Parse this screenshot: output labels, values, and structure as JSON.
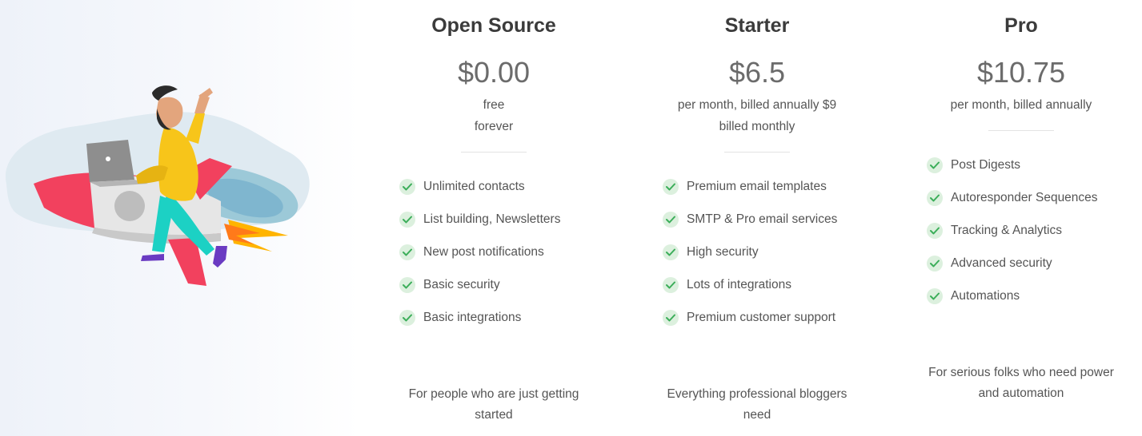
{
  "plans": [
    {
      "name": "Open Source",
      "price": "$0.00",
      "desc_line1": "free",
      "desc_line2": "forever",
      "features": [
        "Unlimited contacts",
        "List building, Newsletters",
        "New post notifications",
        "Basic security",
        "Basic integrations"
      ],
      "footer_line1": "For people who are just getting",
      "footer_line2": "started"
    },
    {
      "name": "Starter",
      "price": "$6.5",
      "desc_line1": "per month, billed annually $9",
      "desc_line2": "billed monthly",
      "features": [
        "Premium email templates",
        "SMTP & Pro email services",
        "High security",
        "Lots of integrations",
        "Premium customer support"
      ],
      "footer_line1": "Everything professional bloggers",
      "footer_line2": "need"
    },
    {
      "name": "Pro",
      "price": "$10.75",
      "desc_line1": "per month, billed annually",
      "features": [
        "Post Digests",
        "Autoresponder Sequences",
        "Tracking & Analytics",
        "Advanced security",
        "Automations"
      ],
      "footer_line1": "For serious folks who need power",
      "footer_line2": "and automation"
    }
  ],
  "colors": {
    "check_bg": "#dcf0de",
    "check_mark": "#3cae5a",
    "rocket_red": "#f2415e",
    "shirt_yellow": "#f7c51a",
    "pants_teal": "#1cd1c4"
  }
}
